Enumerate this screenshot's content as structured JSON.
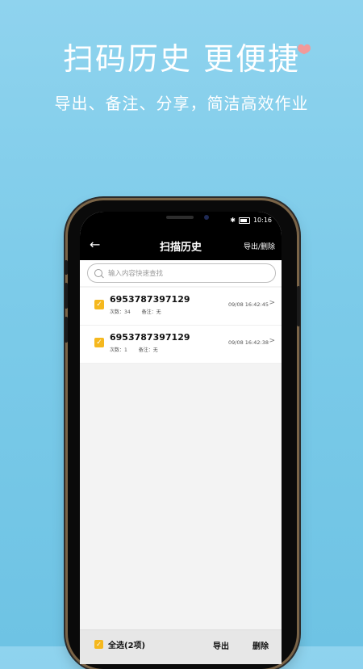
{
  "promo": {
    "headline": "扫码历史 更便捷",
    "subline": "导出、备注、分享，简洁高效作业"
  },
  "status": {
    "time": "10:16",
    "bluetooth_icon": "bluetooth-icon",
    "battery_icon": "battery-icon"
  },
  "header": {
    "back_icon": "back-arrow-icon",
    "title": "扫描历史",
    "action": "导出/删除"
  },
  "search": {
    "placeholder": "输入内容快速查找"
  },
  "items": [
    {
      "code": "6953787397129",
      "count_text": "次数：34",
      "note_text": "备注：无",
      "time": "09/08 16:42:45"
    },
    {
      "code": "6953787397129",
      "count_text": "次数：1",
      "note_text": "备注：无",
      "time": "09/08 16:42:38"
    }
  ],
  "bottom": {
    "select_all": "全选(2项)",
    "export": "导出",
    "delete": "删除"
  },
  "colors": {
    "accent": "#f5b81e",
    "background": "#7ccbe9"
  }
}
